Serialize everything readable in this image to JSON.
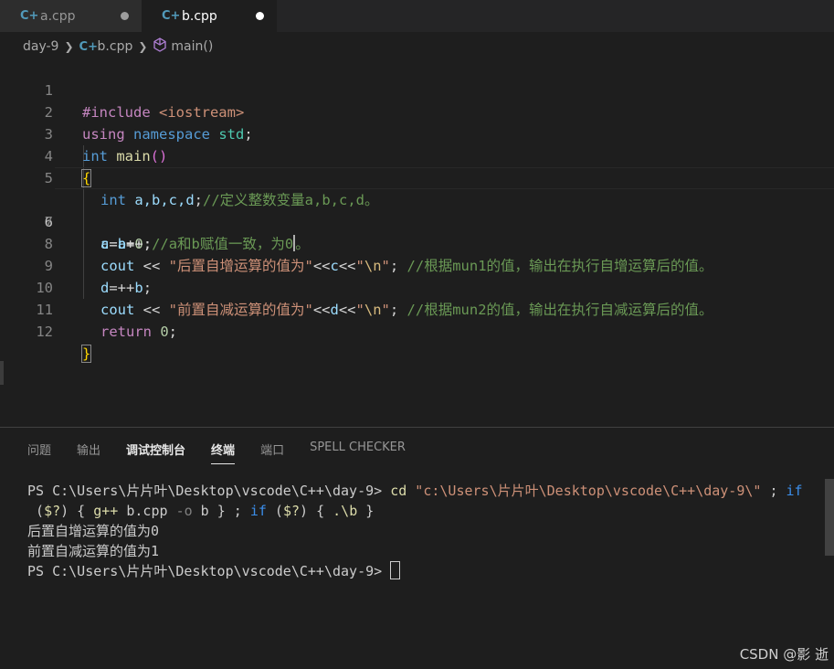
{
  "tabs": [
    {
      "label": "a.cpp",
      "icon": "cpp-file-icon",
      "active": false
    },
    {
      "label": "b.cpp",
      "icon": "cpp-file-icon",
      "active": true
    }
  ],
  "breadcrumb": {
    "folder": "day-9",
    "file": "b.cpp",
    "symbol": "main()"
  },
  "editor": {
    "lines": [
      "1",
      "2",
      "3",
      "4",
      "5",
      "6",
      "7",
      "8",
      "9",
      "10",
      "11",
      "12"
    ],
    "current_line": "6",
    "code": {
      "l1a": "#include",
      "l1b": " <iostream>",
      "l2a": "using",
      "l2b": " namespace",
      "l2c": " std",
      "l2d": ";",
      "l3a": "int",
      "l3b": " main",
      "l3c": "()",
      "l4a": "{",
      "l5a": "int",
      "l5b": " a,b,c,d",
      "l5c": ";",
      "l5d": "//定义整数变量a,b,c,d。",
      "l6a": "a",
      "l6b": "=",
      "l6c": "b",
      "l6d": "=",
      "l6e": "0",
      "l6f": ";",
      "l6g": "//a和b赋值一致，为0",
      "l6h": "。",
      "l7a": "c",
      "l7b": "=",
      "l7c": "a",
      "l7d": "++;",
      "l8a": "cout",
      "l8b": " << ",
      "l8c": "\"后置自增运算的值为\"",
      "l8d": "<<",
      "l8e": "c",
      "l8f": "<<",
      "l8g": "\"",
      "l8h": "\\n",
      "l8i": "\"",
      "l8j": "; ",
      "l8k": "//根据mun1的值，输出在执行自增运算后的值。",
      "l9a": "d",
      "l9b": "=++",
      "l9c": "b",
      "l9d": ";",
      "l10a": "cout",
      "l10b": " << ",
      "l10c": "\"前置自减运算的值为\"",
      "l10d": "<<",
      "l10e": "d",
      "l10f": "<<",
      "l10g": "\"",
      "l10h": "\\n",
      "l10i": "\"",
      "l10j": "; ",
      "l10k": "//根据mun2的值，输出在执行自减运算后的值。",
      "l11a": "return",
      "l11b": " 0",
      "l11c": ";",
      "l12a": "}"
    }
  },
  "panel": {
    "tabs": [
      "问题",
      "输出",
      "调试控制台",
      "终端",
      "端口",
      "SPELL CHECKER"
    ],
    "selected_tab": "终端"
  },
  "terminal": {
    "prompt1": "PS C:\\Users\\片片叶\\Desktop\\vscode\\C++\\day-9> ",
    "cmd1": "cd",
    "str1": " \"c:\\Users\\片片叶\\Desktop\\vscode\\C++\\day-9\\\"",
    "sep1": " ; ",
    "if1": "if",
    "line2a": " (",
    "var1": "$?",
    "line2b": ") { ",
    "cmd2": "g++",
    "line2c": " b.cpp ",
    "arg1": "-o",
    "line2d": " b } ; ",
    "if2": "if",
    "line2e": " (",
    "var2": "$?",
    "line2f": ") { ",
    "cmd3": ".\\b",
    "line2g": " }",
    "out1": "后置自增运算的值为0",
    "out2": "前置自减运算的值为1",
    "prompt2": "PS C:\\Users\\片片叶\\Desktop\\vscode\\C++\\day-9> "
  },
  "watermark": "CSDN @影 逝"
}
